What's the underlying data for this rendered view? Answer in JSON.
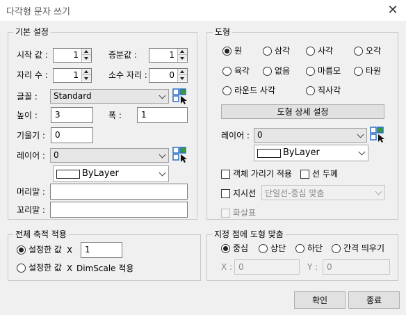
{
  "window": {
    "title": "다각형 문자 쓰기",
    "close_glyph": "✕"
  },
  "basic": {
    "legend": "기본 설정",
    "start_label": "시작 값 :",
    "start_value": "1",
    "increment_label": "증분값 :",
    "increment_value": "1",
    "digits_label": "자리 수 :",
    "digits_value": "1",
    "decimal_label": "소수 자리 :",
    "decimal_value": "0",
    "font_label": "글꼴 :",
    "font_value": "Standard",
    "height_label": "높이 :",
    "height_value": "3",
    "width_label": "폭 :",
    "width_value": "1",
    "slant_label": "기울기 :",
    "slant_value": "0",
    "layer_label": "레이어 :",
    "layer_value": "0",
    "color_value": "ByLayer",
    "prefix_label": "머리말 :",
    "prefix_value": "",
    "suffix_label": "꼬리말 :",
    "suffix_value": ""
  },
  "shape": {
    "legend": "도형",
    "options": [
      "원",
      "삼각",
      "사각",
      "오각",
      "육각",
      "없음",
      "마름모",
      "타원",
      "라운드 사각",
      "직사각"
    ],
    "selected": "원",
    "detail_button": "도형 상세 설정",
    "layer_label": "레이어 :",
    "layer_value": "0",
    "color_value": "ByLayer",
    "hide_object_label": "객체 가리기 적용",
    "line_thickness_label": "선 두께",
    "leader_label": "지시선",
    "leader_type_value": "단일선-중심 맞춤",
    "arrow_label": "화살표"
  },
  "scale": {
    "legend": "전체 축적 적용",
    "set_value_label": "설정한 값",
    "x_label": "X",
    "set_value": "1",
    "dimscale_label": "설정한 값",
    "dimscale_x": "X",
    "dimscale_text": "DimScale 적용"
  },
  "fit": {
    "legend": "지정 점에 도형 맞춤",
    "options": [
      "중심",
      "상단",
      "하단",
      "간격 띄우기"
    ],
    "selected": "중심",
    "x_label": "X :",
    "x_value": "0",
    "y_label": "Y :",
    "y_value": "0"
  },
  "footer": {
    "ok": "확인",
    "close": "종료"
  },
  "icons": {
    "picker": "layer-picker-icon"
  },
  "colors": {
    "accent_blue": "#2b6fc4",
    "accent_green": "#3a9a3a"
  }
}
